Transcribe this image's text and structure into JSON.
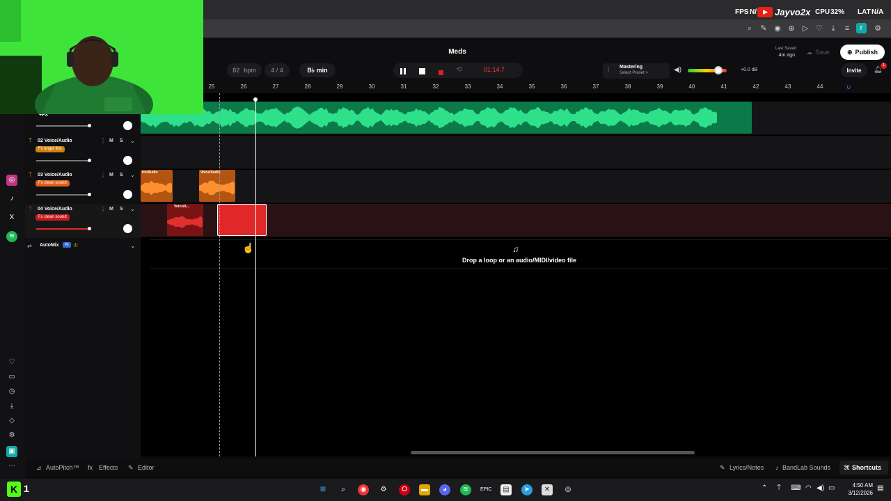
{
  "overlay": {
    "fps_label": "FPS",
    "fps_value": "N/",
    "channel_name": "Jayvo2x",
    "cpu_label": "CPU",
    "cpu_value": "32%",
    "lat_label": "LAT",
    "lat_value": "N/A"
  },
  "project": {
    "title": "Meds",
    "bpm_value": "82",
    "bpm_label": "bpm",
    "time_signature": "4 / 4",
    "key": "B♭ min",
    "time_display": "01:14.7",
    "last_saved_label": "Last Saved",
    "last_saved_value": "4m ago",
    "save_label": "Save",
    "publish_label": "Publish",
    "invite_label": "Invite",
    "notification_count": "1",
    "mastering_label": "Mastering",
    "mastering_preset": "Select Preset >",
    "volume_db": "+0.0 dB",
    "volume_level": 0.78
  },
  "ruler": {
    "bars": [
      "25",
      "26",
      "27",
      "28",
      "29",
      "30",
      "31",
      "32",
      "33",
      "34",
      "35",
      "36",
      "37",
      "38",
      "39",
      "40",
      "41",
      "42",
      "43",
      "44"
    ]
  },
  "tracks": [
    {
      "name": "+FX",
      "fx": ""
    },
    {
      "name": "02 Voice/Audio",
      "fx": "Fx angel libs"
    },
    {
      "name": "03 Voice/Audio",
      "fx": "Fx clean sound"
    },
    {
      "name": "04 Voice/Audio",
      "fx": "Fx clean sound"
    }
  ],
  "track_controls": {
    "mute": "M",
    "solo": "S"
  },
  "clips": {
    "track3_clip1": "ice/Audio",
    "track3_clip2": "Voice/Audio",
    "track4_clip1": "Voice/A..."
  },
  "automix": {
    "label": "AutoMix",
    "badge": "AI"
  },
  "drop_zone": {
    "text": "Drop a loop or an audio/MIDI/video file"
  },
  "bottom_bar": {
    "autopitch": "AutoPitch™",
    "effects": "Effects",
    "editor": "Editor",
    "lyrics": "Lyrics/Notes",
    "sounds": "BandLab Sounds",
    "shortcuts": "Shortcuts"
  },
  "taskbar": {
    "time": "4:50 AM",
    "date": "3/12/2026"
  },
  "colors": {
    "green_track": "#1fcf7a",
    "orange_track": "#f07a22",
    "red_track": "#e02828",
    "time_red": "#ff3b3b"
  }
}
